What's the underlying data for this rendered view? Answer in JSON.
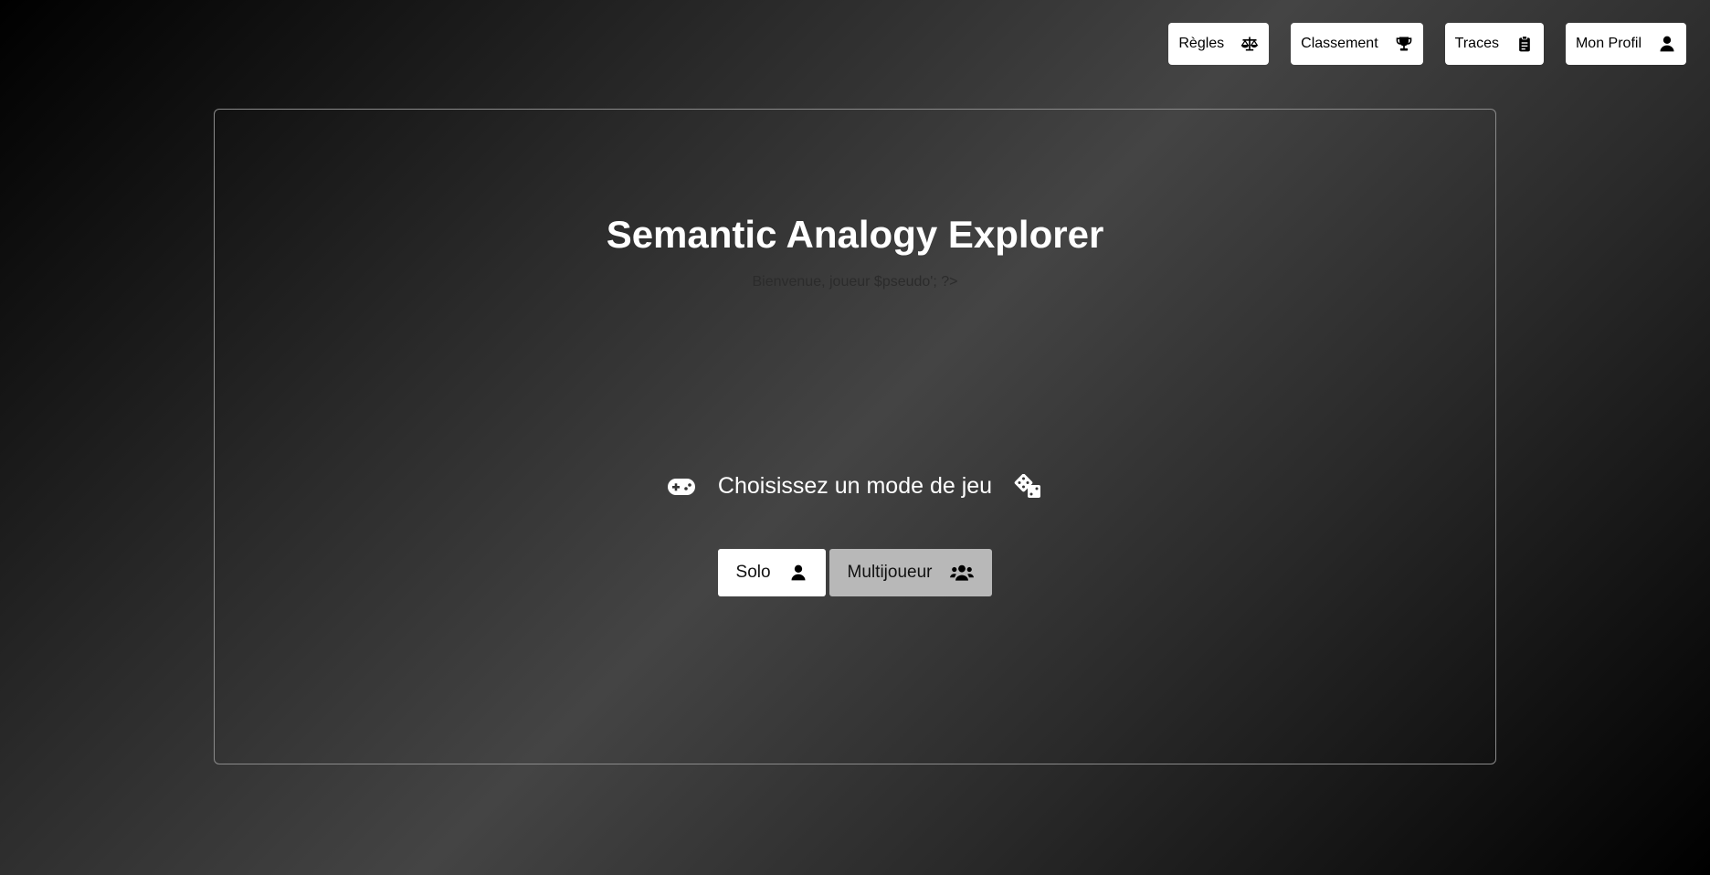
{
  "nav": {
    "items": [
      {
        "label": "Règles",
        "icon": "scale-icon"
      },
      {
        "label": "Classement",
        "icon": "trophy-icon"
      },
      {
        "label": "Traces",
        "icon": "clipboard-icon"
      },
      {
        "label": "Mon Profil",
        "icon": "user-icon"
      }
    ]
  },
  "main": {
    "title": "Semantic Analogy Explorer",
    "welcome": "Bienvenue, joueur $pseudo'; ?>",
    "mode_heading": "Choisissez un mode de jeu",
    "mode_heading_left_icon": "gamepad-icon",
    "mode_heading_right_icon": "dice-icon",
    "modes": [
      {
        "label": "Solo",
        "icon": "user-icon"
      },
      {
        "label": "Multijoueur",
        "icon": "users-icon"
      }
    ]
  },
  "colors": {
    "background_dark": "#000000",
    "background_light": "#444444",
    "button_white": "#ffffff",
    "button_grey": "#b8b8b8"
  }
}
